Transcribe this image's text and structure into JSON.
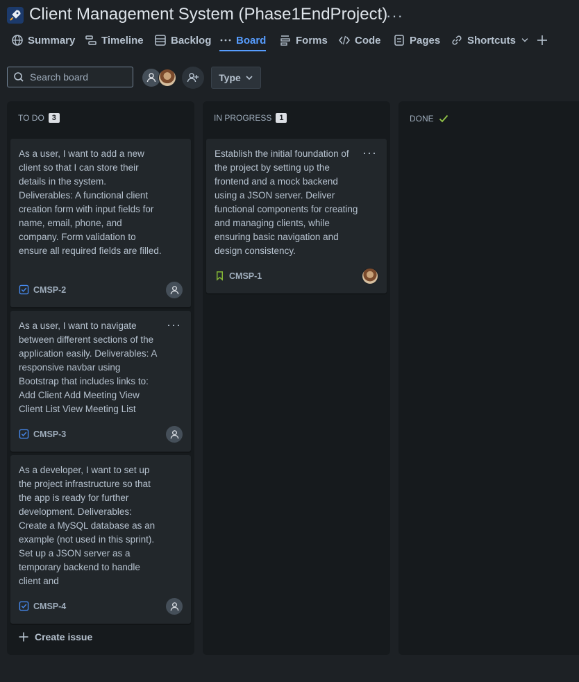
{
  "header": {
    "title": "Client Management System (Phase1EndProject)",
    "more": "···"
  },
  "tabs": [
    {
      "label": "Summary",
      "icon": "globe-icon"
    },
    {
      "label": "Timeline",
      "icon": "timeline-icon"
    },
    {
      "label": "Backlog",
      "icon": "backlog-icon"
    },
    {
      "label": "Board",
      "icon": "more-dots-icon",
      "active": true
    },
    {
      "label": "Forms",
      "icon": "forms-icon"
    },
    {
      "label": "Code",
      "icon": "code-icon"
    },
    {
      "label": "Pages",
      "icon": "pages-icon"
    },
    {
      "label": "Shortcuts",
      "icon": "link-icon"
    }
  ],
  "toolbar": {
    "search_placeholder": "Search board",
    "type_label": "Type"
  },
  "columns": [
    {
      "title": "TO DO",
      "count": "3",
      "cards": [
        {
          "text": "As a user, I want to add a new client so that I can store their details in the system. Deliverables: A functional client creation form with input fields for name, email, phone, and company. Form validation to ensure all required fields are filled.",
          "key": "CMSP-2"
        },
        {
          "text": "As a user, I want to navigate between different sections of the application easily. Deliverables: A responsive navbar using Bootstrap that includes links to: Add Client Add Meeting View Client List View Meeting List",
          "key": "CMSP-3"
        },
        {
          "text": "As a developer, I want to set up the project infrastructure so that the app is ready for further development. Deliverables: Create a MySQL database as an example (not used in this sprint). Set up a JSON server as a temporary backend to handle client and",
          "key": "CMSP-4"
        }
      ],
      "create_issue": "Create issue"
    },
    {
      "title": "IN PROGRESS",
      "count": "1",
      "cards": [
        {
          "text": "Establish the initial foundation of the project by setting up the frontend and a mock backend using a JSON server. Deliver functional components for creating and managing clients, while ensuring basic navigation and design consistency.",
          "key": "CMSP-1"
        }
      ]
    },
    {
      "title": "DONE"
    }
  ],
  "colors": {
    "background": "#1d2125",
    "column": "#161a1d",
    "card": "#22272b",
    "accent": "#579dff",
    "task_icon": "#4688ec",
    "story_icon": "#82b536",
    "done_check": "#94c748"
  }
}
